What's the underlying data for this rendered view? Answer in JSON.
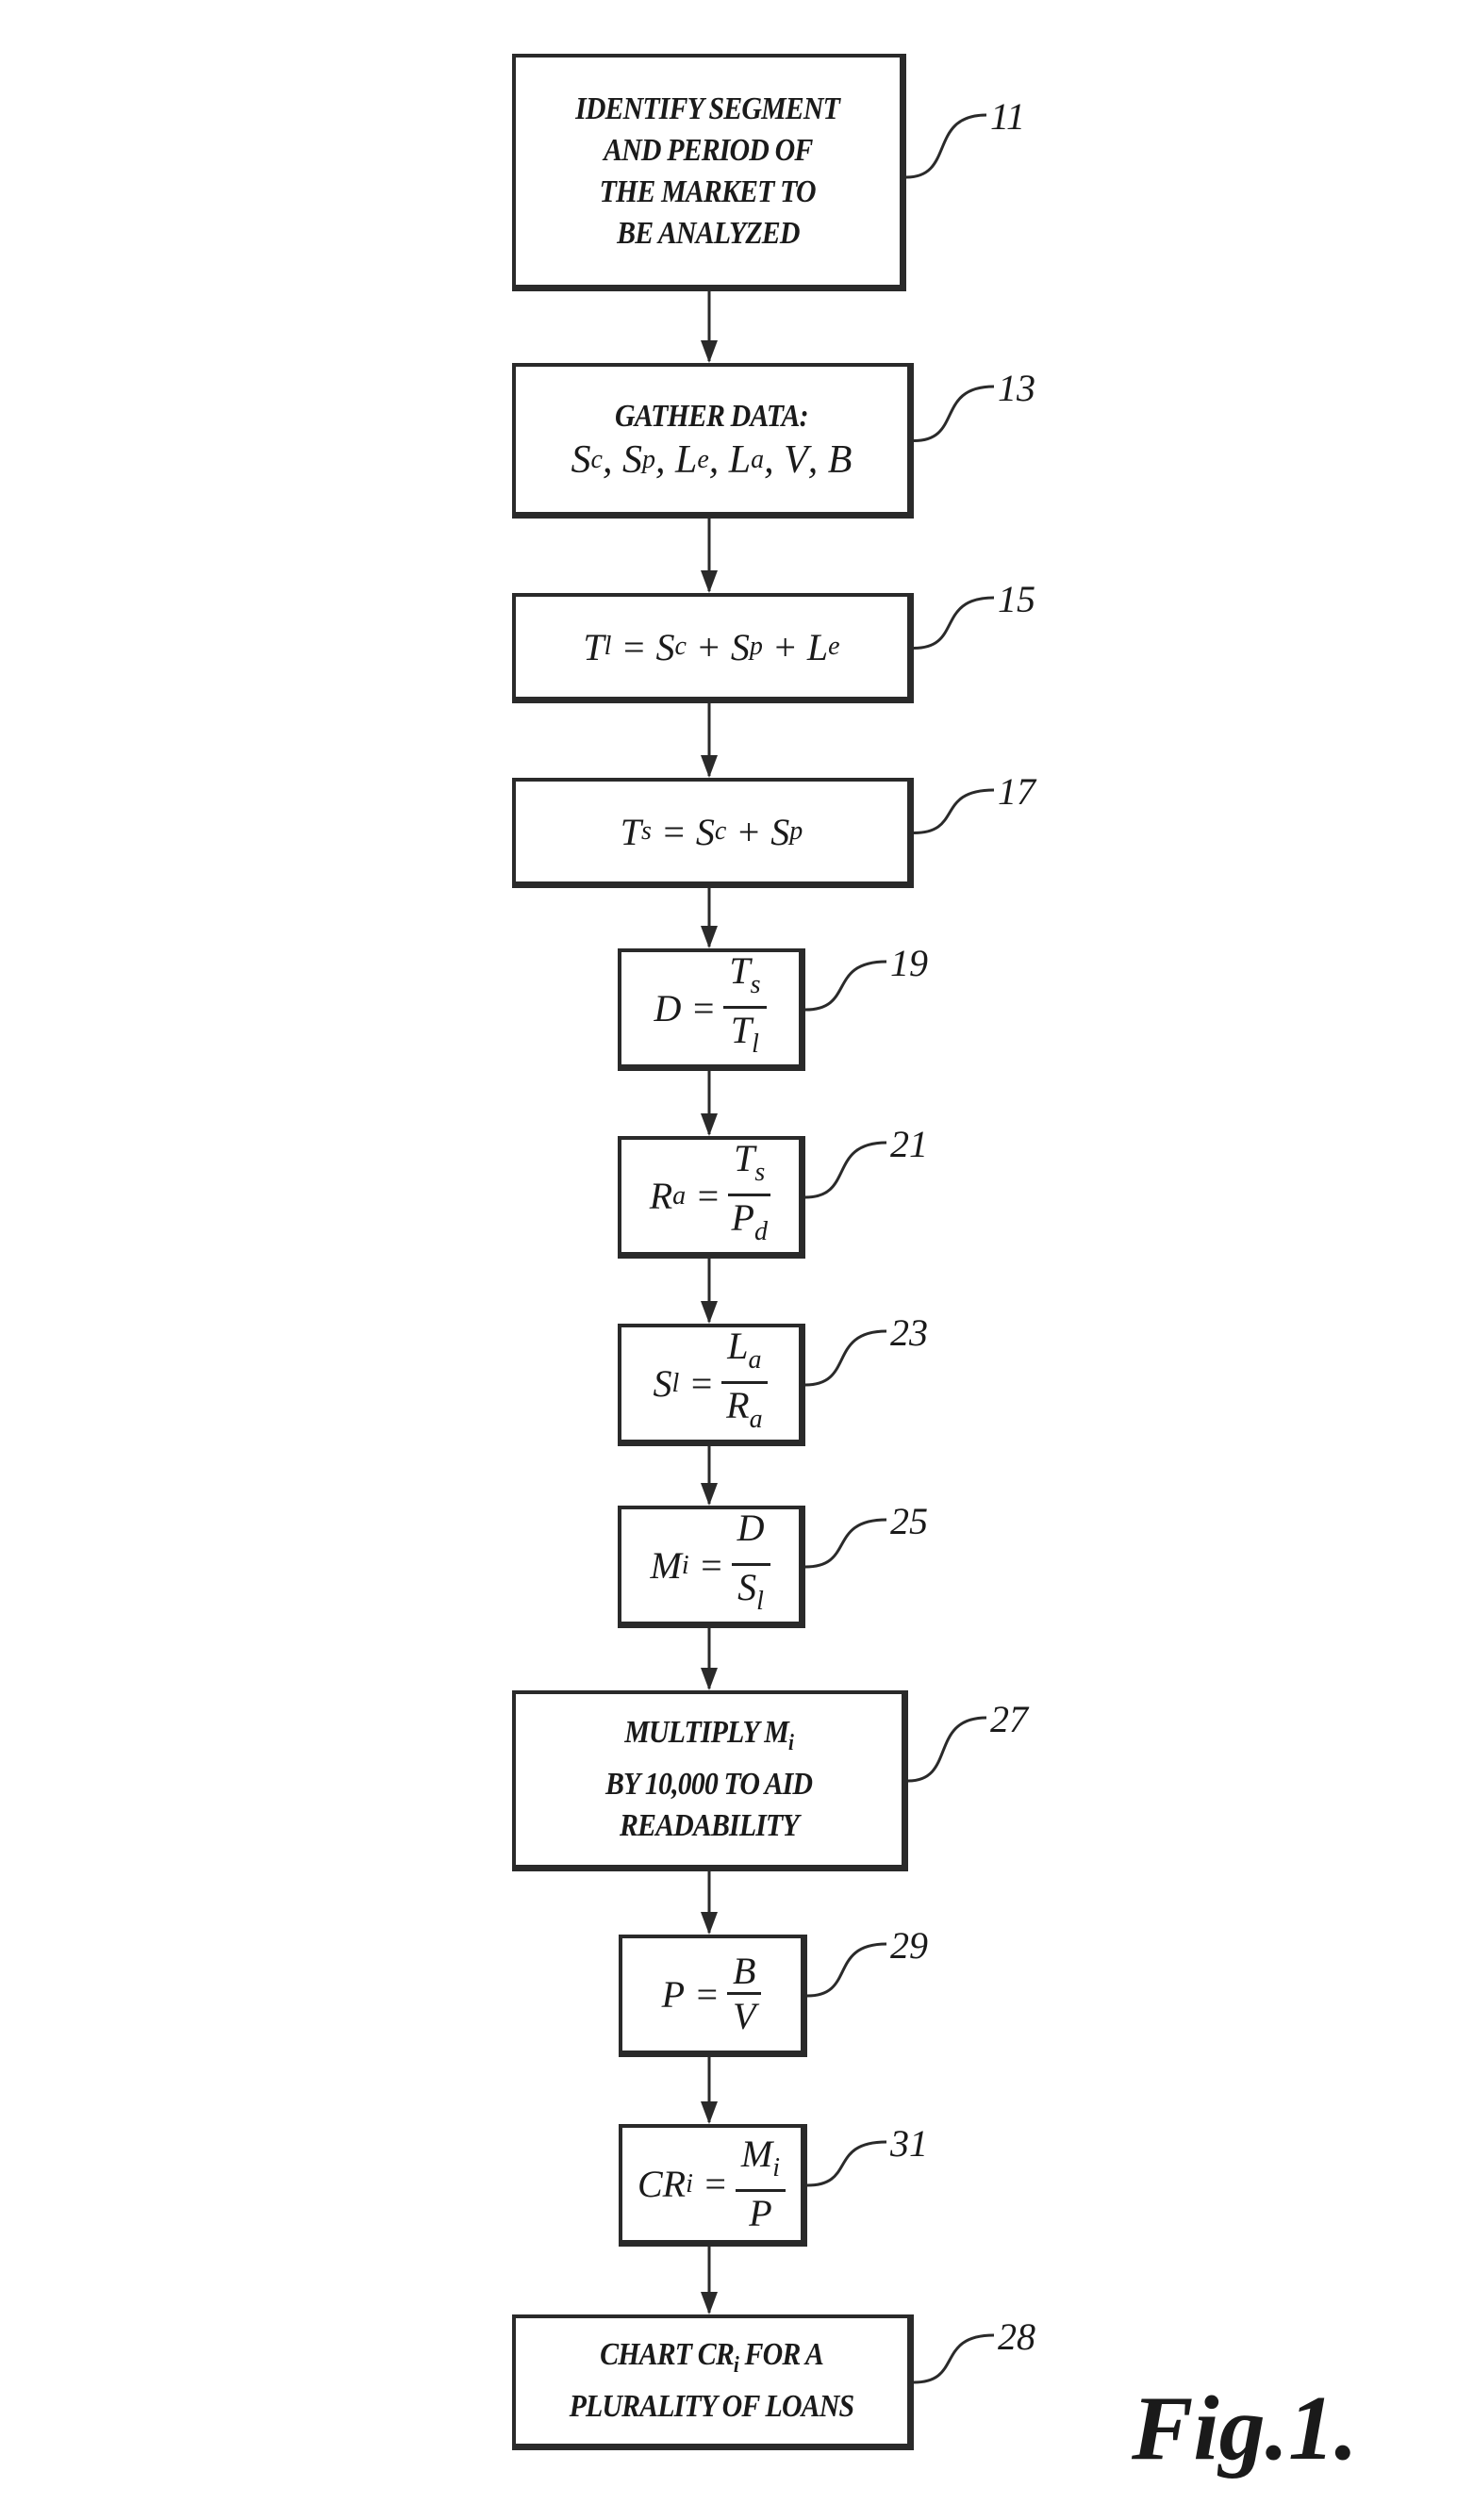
{
  "figure_label": "Fig.1.",
  "steps": [
    {
      "ref": "11",
      "lines": [
        "IDENTIFY SEGMENT",
        "AND PERIOD OF",
        "THE MARKET TO",
        "BE ANALYZED"
      ]
    },
    {
      "ref": "13",
      "lines": [
        "GATHER DATA:"
      ],
      "vars": [
        "S",
        "c",
        "S",
        "p",
        "L",
        "e",
        "L",
        "a",
        "V",
        "B"
      ]
    },
    {
      "ref": "15",
      "formula": {
        "lhs": "T",
        "lhs_sub": "l",
        "terms": [
          "S",
          "c",
          "S",
          "p",
          "L",
          "e"
        ]
      }
    },
    {
      "ref": "17",
      "formula": {
        "lhs": "T",
        "lhs_sub": "s",
        "terms": [
          "S",
          "c",
          "S",
          "p"
        ]
      }
    },
    {
      "ref": "19",
      "formula": {
        "lhs": "D",
        "lhs_sub": "",
        "num": "T",
        "num_sub": "s",
        "den": "T",
        "den_sub": "l"
      }
    },
    {
      "ref": "21",
      "formula": {
        "lhs": "R",
        "lhs_sub": "a",
        "num": "T",
        "num_sub": "s",
        "den": "P",
        "den_sub": "d"
      }
    },
    {
      "ref": "23",
      "formula": {
        "lhs": "S",
        "lhs_sub": "l",
        "num": "L",
        "num_sub": "a",
        "den": "R",
        "den_sub": "a"
      }
    },
    {
      "ref": "25",
      "formula": {
        "lhs": "M",
        "lhs_sub": "i",
        "num": "D",
        "num_sub": "",
        "den": "S",
        "den_sub": "l"
      }
    },
    {
      "ref": "27",
      "lines": [
        "MULTIPLY M",
        "BY 10,000 TO AID",
        "READABILITY"
      ],
      "line1_sub": "i"
    },
    {
      "ref": "29",
      "formula": {
        "lhs": "P",
        "lhs_sub": "",
        "num": "B",
        "num_sub": "",
        "den": "V",
        "den_sub": ""
      }
    },
    {
      "ref": "31",
      "formula": {
        "lhs": "CR",
        "lhs_sub": "i",
        "num": "M",
        "num_sub": "i",
        "den": "P",
        "den_sub": ""
      }
    },
    {
      "ref": "28",
      "lines": [
        "CHART CR",
        "PLURALITY OF LOANS"
      ],
      "line1_sub": "i",
      "line1_suffix": " FOR A"
    }
  ],
  "symbols": {
    "equals": "=",
    "plus": "+",
    "comma": ","
  }
}
